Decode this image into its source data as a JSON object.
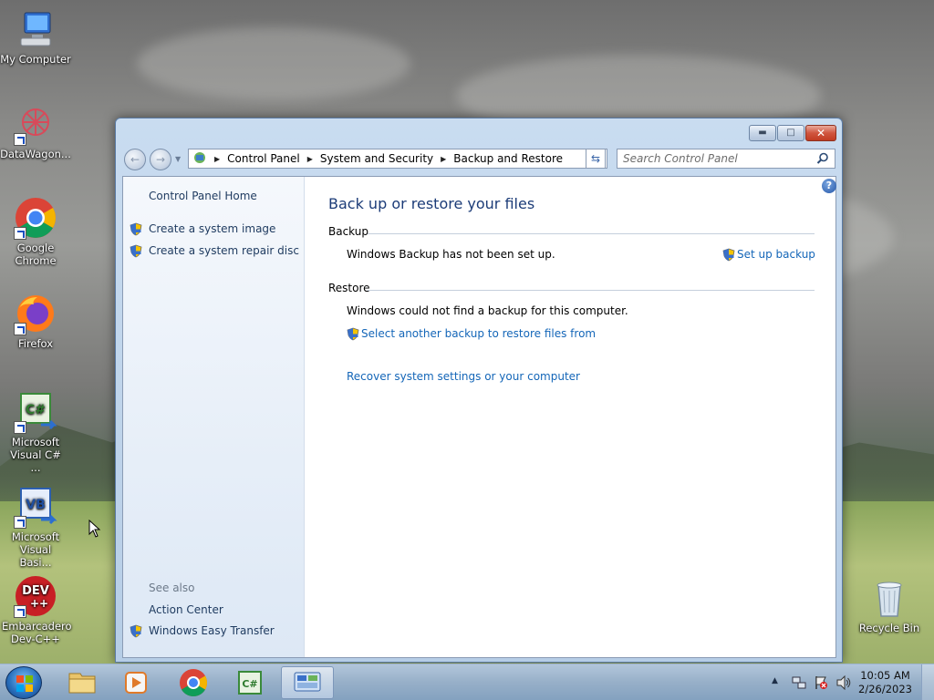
{
  "desktop": {
    "icons": [
      {
        "label": "My Computer"
      },
      {
        "label": "DataWagon..."
      },
      {
        "label": "Google Chrome"
      },
      {
        "label": "Firefox"
      },
      {
        "label": "Microsoft Visual C# ..."
      },
      {
        "label": "Microsoft Visual Basi..."
      },
      {
        "label": "Embarcadero Dev-C++"
      },
      {
        "label": "Recycle Bin"
      }
    ]
  },
  "window": {
    "breadcrumbs": [
      "Control Panel",
      "System and Security",
      "Backup and Restore"
    ],
    "search_placeholder": "Search Control Panel",
    "left_pane": {
      "home": "Control Panel Home",
      "links": [
        "Create a system image",
        "Create a system repair disc"
      ],
      "see_also_title": "See also",
      "see_also": [
        "Action Center",
        "Windows Easy Transfer"
      ]
    },
    "main": {
      "title": "Back up or restore your files",
      "backup": {
        "heading": "Backup",
        "status": "Windows Backup has not been set up.",
        "action": "Set up backup"
      },
      "restore": {
        "heading": "Restore",
        "status": "Windows could not find a backup for this computer.",
        "select_link": "Select another backup to restore files from",
        "recover_link": "Recover system settings or your computer"
      },
      "help_glyph": "?"
    }
  },
  "taskbar": {
    "time": "10:05 AM",
    "date": "2/26/2023",
    "buttons": [
      "windows-explorer",
      "media-player",
      "google-chrome",
      "visual-csharp",
      "control-panel"
    ]
  },
  "colors": {
    "link": "#1466b8",
    "heading": "#1c3c78",
    "left_pane_text": "#1e3a5f"
  }
}
